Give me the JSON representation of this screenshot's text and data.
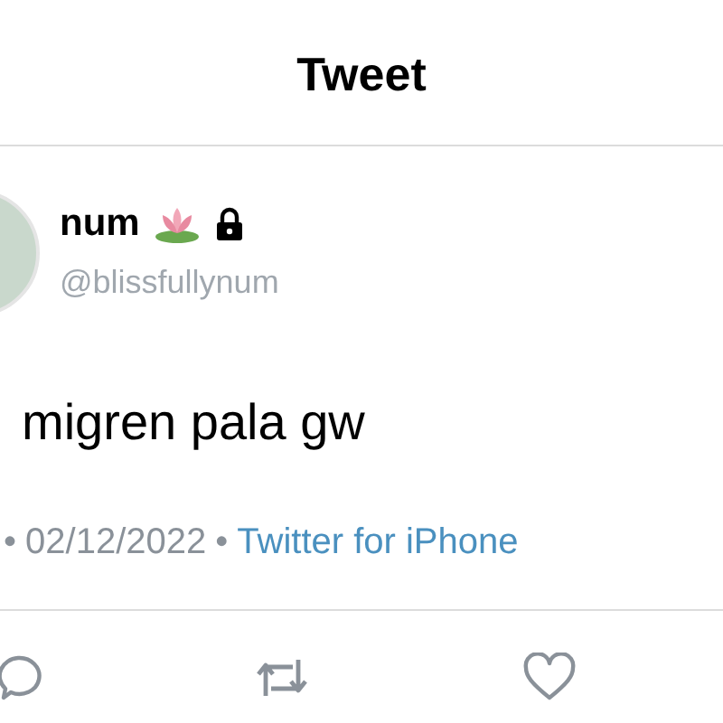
{
  "header": {
    "title": "Tweet"
  },
  "tweet": {
    "name": "num",
    "handle": "@blissfullynum",
    "text": "migren pala gw",
    "meta_separator_1": "•",
    "date": "02/12/2022",
    "meta_separator_2": "•",
    "source": "Twitter for iPhone"
  }
}
